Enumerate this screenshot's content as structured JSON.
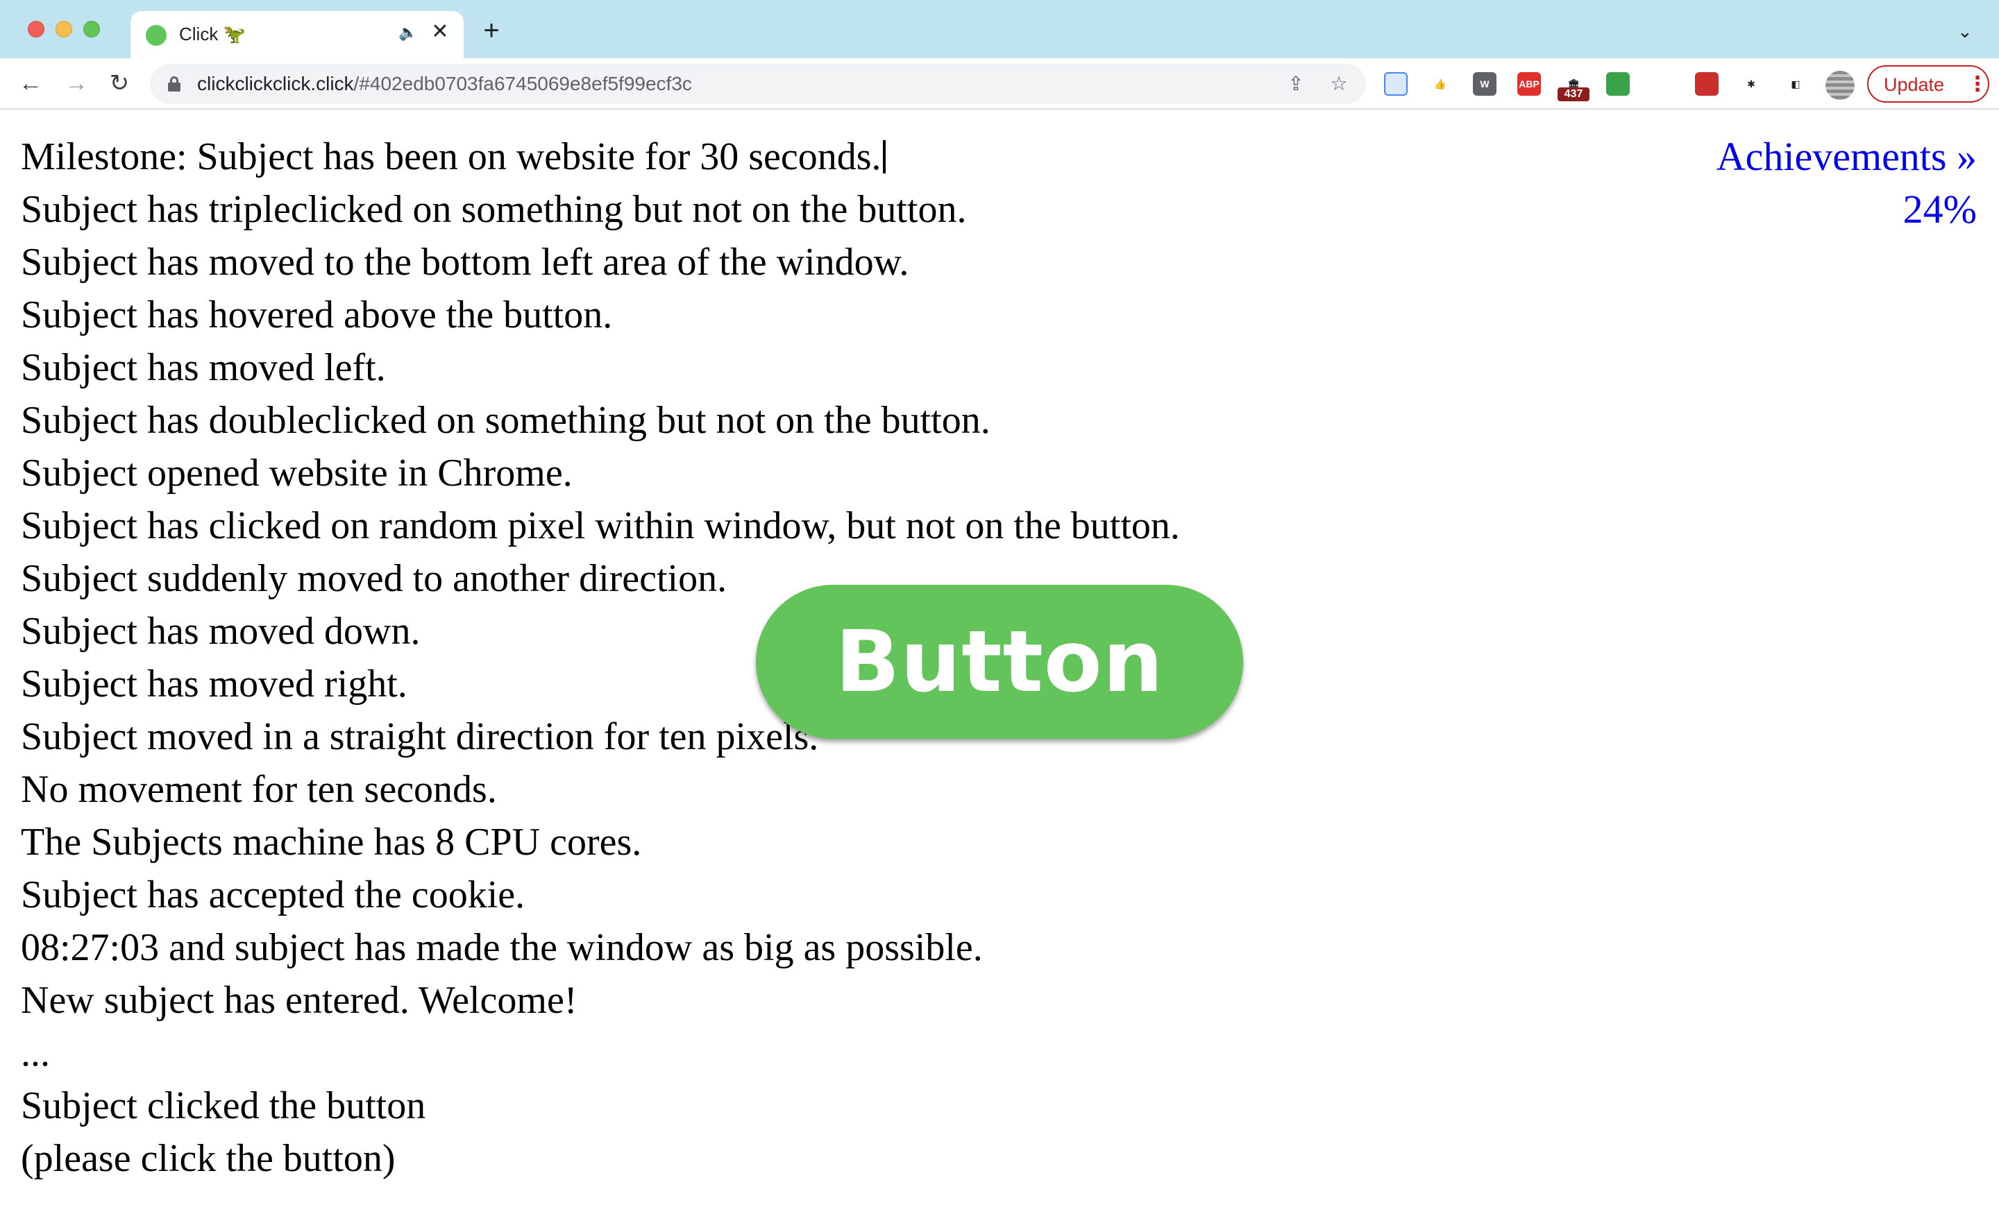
{
  "browser": {
    "tab": {
      "title": "Click 🦖",
      "audio_icon": "speaker-icon",
      "close_glyph": "✕"
    },
    "new_tab_glyph": "+",
    "tab_search_glyph": "⌄",
    "nav": {
      "back_glyph": "←",
      "forward_glyph": "→",
      "reload_glyph": "↻"
    },
    "address": {
      "domain": "clickclickclick.click",
      "path": "/#402edb0703fa6745069e8ef5f99ecf3c"
    },
    "share_glyph": "⇪",
    "star_glyph": "☆",
    "extensions": [
      {
        "name": "docs-extension-icon",
        "label": "",
        "color": "#dbe8fb"
      },
      {
        "name": "thumbs-up-extension-icon",
        "label": "👍",
        "color": "#ffffff"
      },
      {
        "name": "wikiwand-extension-icon",
        "label": "W",
        "color": "#5f6368"
      },
      {
        "name": "adblock-plus-extension-icon",
        "label": "ABP",
        "color": "#e0302c"
      },
      {
        "name": "museum-extension-icon",
        "label": "🏛",
        "color": "#ffffff"
      },
      {
        "name": "green-extension-icon",
        "label": "",
        "color": "#38a34a"
      },
      {
        "name": "timer-extension-icon",
        "label": "",
        "color": "#ffffff"
      },
      {
        "name": "red-square-extension-icon",
        "label": "",
        "color": "#c9302c"
      },
      {
        "name": "puzzle-extension-icon",
        "label": "✱",
        "color": "#ffffff"
      },
      {
        "name": "side-panel-icon",
        "label": "◧",
        "color": "#ffffff"
      }
    ],
    "extension_badge": "437",
    "update_button": {
      "label": "Update",
      "menu_glyph": "⋮"
    }
  },
  "page": {
    "log_lines": [
      "Milestone: Subject has been on website for 30 seconds.",
      "Subject has tripleclicked on something but not on the button.",
      "Subject has moved to the bottom left area of the window.",
      "Subject has hovered above the button.",
      "Subject has moved left.",
      "Subject has doubleclicked on something but not on the button.",
      "Subject opened website in Chrome.",
      "Subject has clicked on random pixel within window, but not on the button.",
      "Subject suddenly moved to another direction.",
      "Subject has moved down.",
      "Subject has moved right.",
      "Subject moved in a straight direction for ten pixels.",
      "No movement for ten seconds.",
      "The Subjects machine has 8 CPU cores.",
      "Subject has accepted the cookie.",
      "08:27:03 and subject has made the window as big as possible.",
      "New subject has entered. Welcome!",
      "...",
      "Subject clicked the button",
      "(please click the button)"
    ],
    "achievements": {
      "label": "Achievements »",
      "percent": "24%"
    },
    "button_label": "Button",
    "colors": {
      "button": "#62c45a",
      "link": "#0000ee",
      "tabstrip": "#bfe3ef",
      "update": "#c5221f"
    }
  }
}
